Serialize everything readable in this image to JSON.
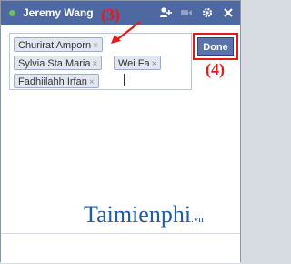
{
  "header": {
    "title": "Jeremy Wang",
    "status": "online"
  },
  "recipients": [
    {
      "name": "Churirat Amporn",
      "remove": "×"
    },
    {
      "name": "Sylvia Sta Maria",
      "remove": "×"
    },
    {
      "name": "Wei Fa",
      "remove": "×"
    },
    {
      "name": "Fadhiilahh Irfan",
      "remove": "×"
    }
  ],
  "actions": {
    "done_label": "Done"
  },
  "annotations": {
    "step3": "(3)",
    "step4": "(4)"
  },
  "watermark": {
    "text": "Taimienphi",
    "suffix": ".vn"
  },
  "colors": {
    "header": "#4e69a2",
    "done": "#5b74a8",
    "annotation": "#e21a1a",
    "online": "#6ec15e"
  }
}
